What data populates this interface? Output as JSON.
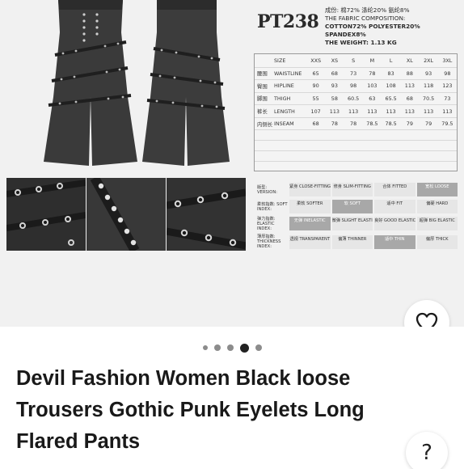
{
  "product_image": {
    "code": "PT238",
    "composition_lines": [
      "成份: 棉72% 涤纶20% 氨纶8%",
      "THE FABRIC COMPOSITION:",
      "COTTON72% POLYESTER20%",
      "SPANDEX8%",
      "THE WEIGHT: 1.13 KG"
    ],
    "size_table": {
      "headers": [
        "",
        "SIZE",
        "XXS",
        "XS",
        "S",
        "M",
        "L",
        "XL",
        "2XL",
        "3XL"
      ],
      "rows": [
        [
          "腰围",
          "WAISTLINE",
          "65",
          "68",
          "73",
          "78",
          "83",
          "88",
          "93",
          "98"
        ],
        [
          "臀围",
          "HIPLINE",
          "90",
          "93",
          "98",
          "103",
          "108",
          "113",
          "118",
          "123"
        ],
        [
          "脚围",
          "THIGH",
          "55",
          "58",
          "60.5",
          "63",
          "65.5",
          "68",
          "70.5",
          "73"
        ],
        [
          "裤长",
          "LENGTH",
          "107",
          "113",
          "113",
          "113",
          "113",
          "113",
          "113",
          "113"
        ],
        [
          "内侧长",
          "INSEAM",
          "68",
          "78",
          "78",
          "78.5",
          "78.5",
          "79",
          "79",
          "79.5"
        ]
      ]
    },
    "fit_grid": [
      {
        "label": "版型: VERSION:",
        "cells": [
          "紧身 CLOSE-FITTING",
          "修身 SLIM-FITTING",
          "合体 FITTED",
          "宽松 LOOSE"
        ],
        "selected": 3
      },
      {
        "label": "柔软指数: SOFT INDEX:",
        "cells": [
          "柔软 SOFTER",
          "软 SOFT",
          "适中 FIT",
          "偏硬 HARD"
        ],
        "selected": 1
      },
      {
        "label": "弹力指数: ELASTIC INDEX:",
        "cells": [
          "无弹 INELASTIC",
          "微弹 SLIGHT ELASTIC",
          "良好 GOOD ELASTIC",
          "超弹 BIG ELASTIC"
        ],
        "selected": 0
      },
      {
        "label": "薄厚指数: THICKNESS INDEX:",
        "cells": [
          "透视 TRANSPARENT",
          "偏薄 THINNER",
          "适中 THIN",
          "偏厚 THICK"
        ],
        "selected": 2
      }
    ]
  },
  "carousel": {
    "count": 5,
    "active_index": 3
  },
  "title": "Devil Fashion Women Black loose Trousers Gothic Punk Eyelets Long Flared Pants",
  "icons": {
    "like": "heart-icon",
    "help": "question-icon"
  },
  "help_label": "?"
}
